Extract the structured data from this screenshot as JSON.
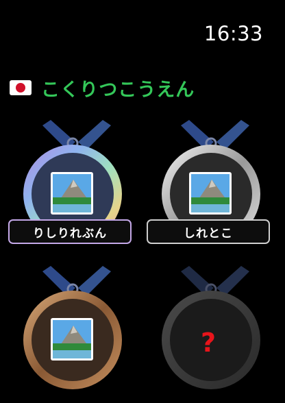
{
  "status_bar": {
    "time": "16:33"
  },
  "header": {
    "flag_icon": "japan-flag-icon",
    "title": "こくりつこうえん",
    "title_color": "#34c759"
  },
  "badges": [
    {
      "name": "りしりれぶん",
      "medal": "rainbow",
      "unlocked": true,
      "image_icon": "national-park-photo-icon"
    },
    {
      "name": "しれとこ",
      "medal": "silver",
      "unlocked": true,
      "image_icon": "national-park-photo-icon"
    },
    {
      "name": "",
      "medal": "bronze",
      "unlocked": true,
      "image_icon": "national-park-photo-icon"
    },
    {
      "name": "",
      "medal": "locked",
      "unlocked": false,
      "locked_mark": "?"
    }
  ],
  "colors": {
    "ribbon": "#2e4a8a",
    "locked_mark": "#e8141b",
    "background": "#000000"
  }
}
